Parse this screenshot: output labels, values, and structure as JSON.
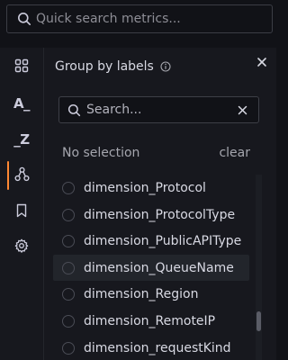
{
  "top_search": {
    "placeholder": "Quick search metrics..."
  },
  "rail": {
    "items": [
      {
        "name": "grid",
        "text": ""
      },
      {
        "name": "a-underscore",
        "text": "A_"
      },
      {
        "name": "underscore-z",
        "text": "_Z"
      },
      {
        "name": "group-labels",
        "text": ""
      },
      {
        "name": "bookmark",
        "text": ""
      },
      {
        "name": "settings",
        "text": ""
      }
    ],
    "active": "group-labels",
    "accent": "#ff8833"
  },
  "panel": {
    "title": "Group by labels",
    "search": {
      "placeholder": "Search..."
    },
    "no_selection": "No selection",
    "clear": "clear",
    "items": [
      "dimension_Protocol",
      "dimension_ProtocolType",
      "dimension_PublicAPIType",
      "dimension_QueueName",
      "dimension_Region",
      "dimension_RemoteIP",
      "dimension_requestKind"
    ],
    "hovered_item": "dimension_QueueName"
  }
}
